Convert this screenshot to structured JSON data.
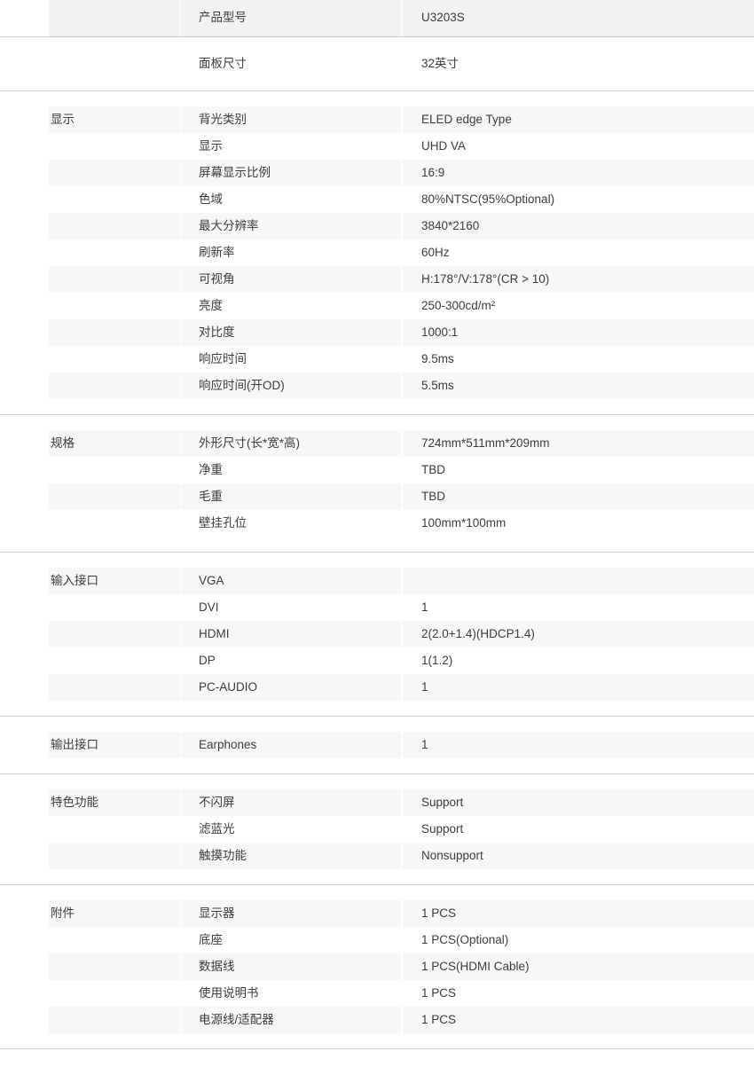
{
  "document": {
    "type": "product-specification-table",
    "colors": {
      "page_background": "#ffffff",
      "stripe_background": "#f7f7f7",
      "lead_stripe_background": "#f2f2f2",
      "divider": "#cccccc",
      "text": "#3c3c3c"
    }
  },
  "lead_rows": [
    {
      "group": "",
      "name": "产品型号",
      "value": "U3203S"
    },
    {
      "group": "",
      "name": "面板尺寸",
      "value": "32英寸"
    }
  ],
  "sections": [
    {
      "group": "显示",
      "rows": [
        {
          "name": "背光类别",
          "value": "ELED edge Type"
        },
        {
          "name": "显示",
          "value": "UHD VA"
        },
        {
          "name": "屏幕显示比例",
          "value": "16:9"
        },
        {
          "name": "色域",
          "value": "80%NTSC(95%Optional)"
        },
        {
          "name": "最大分辨率",
          "value": "3840*2160"
        },
        {
          "name": "刷新率",
          "value": "60Hz"
        },
        {
          "name": "可视角",
          "value": "H:178°/V:178°(CR > 10)"
        },
        {
          "name": "亮度",
          "value": "250-300cd/m²"
        },
        {
          "name": "对比度",
          "value": "1000:1"
        },
        {
          "name": "响应时间",
          "value": "9.5ms"
        },
        {
          "name": "响应时间(开OD)",
          "value": "5.5ms"
        }
      ]
    },
    {
      "group": "规格",
      "rows": [
        {
          "name": "外形尺寸(长*宽*高)",
          "value": "724mm*511mm*209mm"
        },
        {
          "name": "净重",
          "value": "TBD"
        },
        {
          "name": "毛重",
          "value": "TBD"
        },
        {
          "name": "壁挂孔位",
          "value": "100mm*100mm"
        }
      ]
    },
    {
      "group": "输入接口",
      "rows": [
        {
          "name": "VGA",
          "value": ""
        },
        {
          "name": "DVI",
          "value": "1"
        },
        {
          "name": "HDMI",
          "value": "2(2.0+1.4)(HDCP1.4)"
        },
        {
          "name": "DP",
          "value": "1(1.2)"
        },
        {
          "name": "PC-AUDIO",
          "value": "1"
        }
      ]
    },
    {
      "group": "输出接口",
      "rows": [
        {
          "name": "Earphones",
          "value": "1"
        }
      ]
    },
    {
      "group": "特色功能",
      "rows": [
        {
          "name": "不闪屏",
          "value": "Support"
        },
        {
          "name": "滤蓝光",
          "value": "Support"
        },
        {
          "name": "触摸功能",
          "value": "Nonsupport"
        }
      ]
    },
    {
      "group": "附件",
      "rows": [
        {
          "name": "显示器",
          "value": "1 PCS"
        },
        {
          "name": "底座",
          "value": "1 PCS(Optional)"
        },
        {
          "name": "数据线",
          "value": "1 PCS(HDMI Cable)"
        },
        {
          "name": "使用说明书",
          "value": "1 PCS"
        },
        {
          "name": "电源线/适配器",
          "value": "1 PCS"
        }
      ]
    }
  ]
}
